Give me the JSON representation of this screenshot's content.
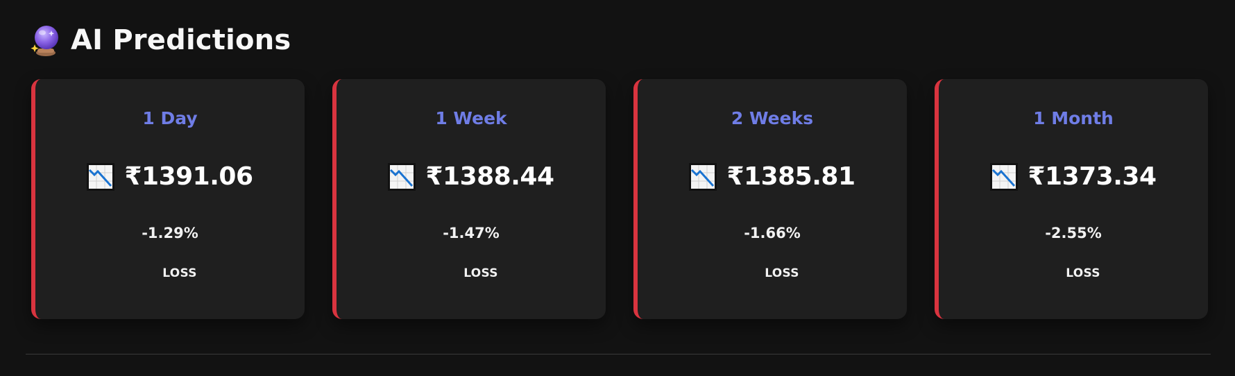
{
  "header": {
    "icon": "crystal-ball-icon",
    "title": "AI Predictions"
  },
  "colors": {
    "background": "#121212",
    "card_background": "#1f1f1f",
    "loss_accent": "#d9343f",
    "period_label": "#6f7de6",
    "text": "#ffffff"
  },
  "predictions": [
    {
      "period": "1 Day",
      "icon": "chart-decreasing-icon",
      "price": "₹1391.06",
      "change": "-1.29%",
      "status": "LOSS"
    },
    {
      "period": "1 Week",
      "icon": "chart-decreasing-icon",
      "price": "₹1388.44",
      "change": "-1.47%",
      "status": "LOSS"
    },
    {
      "period": "2 Weeks",
      "icon": "chart-decreasing-icon",
      "price": "₹1385.81",
      "change": "-1.66%",
      "status": "LOSS"
    },
    {
      "period": "1 Month",
      "icon": "chart-decreasing-icon",
      "price": "₹1373.34",
      "change": "-2.55%",
      "status": "LOSS"
    }
  ]
}
